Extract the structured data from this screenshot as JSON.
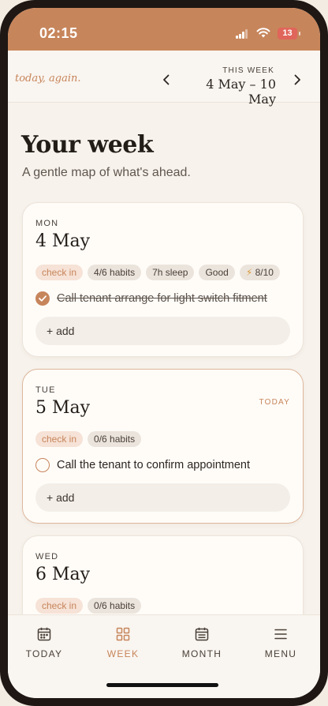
{
  "status_bar": {
    "time": "02:15",
    "battery": "13"
  },
  "header": {
    "brand": "today, again.",
    "week_caption": "THIS WEEK",
    "week_range": "4 May – 10 May"
  },
  "page": {
    "title": "Your week",
    "subtitle": "A gentle map of what's ahead."
  },
  "days": [
    {
      "dow": "MON",
      "date": "4 May",
      "chips": {
        "checkin": "check in",
        "habits": "4/6 habits",
        "sleep": "7h sleep",
        "mood": "Good",
        "energy": "8/10"
      },
      "task": {
        "text": "Call tenant arrange for light switch fitment",
        "done": true
      },
      "add_label": "+ add"
    },
    {
      "dow": "TUE",
      "date": "5 May",
      "today_tag": "TODAY",
      "chips": {
        "checkin": "check in",
        "habits": "0/6 habits"
      },
      "task": {
        "text": "Call the tenant to confirm appointment",
        "done": false
      },
      "add_label": "+ add"
    },
    {
      "dow": "WED",
      "date": "6 May",
      "chips": {
        "checkin": "check in",
        "habits": "0/6 habits"
      }
    }
  ],
  "tabs": [
    {
      "label": "TODAY",
      "icon": "calendar-day-icon",
      "active": false
    },
    {
      "label": "WEEK",
      "icon": "grid-icon",
      "active": true
    },
    {
      "label": "MONTH",
      "icon": "calendar-month-icon",
      "active": false
    },
    {
      "label": "MENU",
      "icon": "hamburger-menu-icon",
      "active": false
    }
  ],
  "colors": {
    "accent": "#c7855b",
    "background": "#f7f2ec",
    "card": "#fffcf8"
  }
}
